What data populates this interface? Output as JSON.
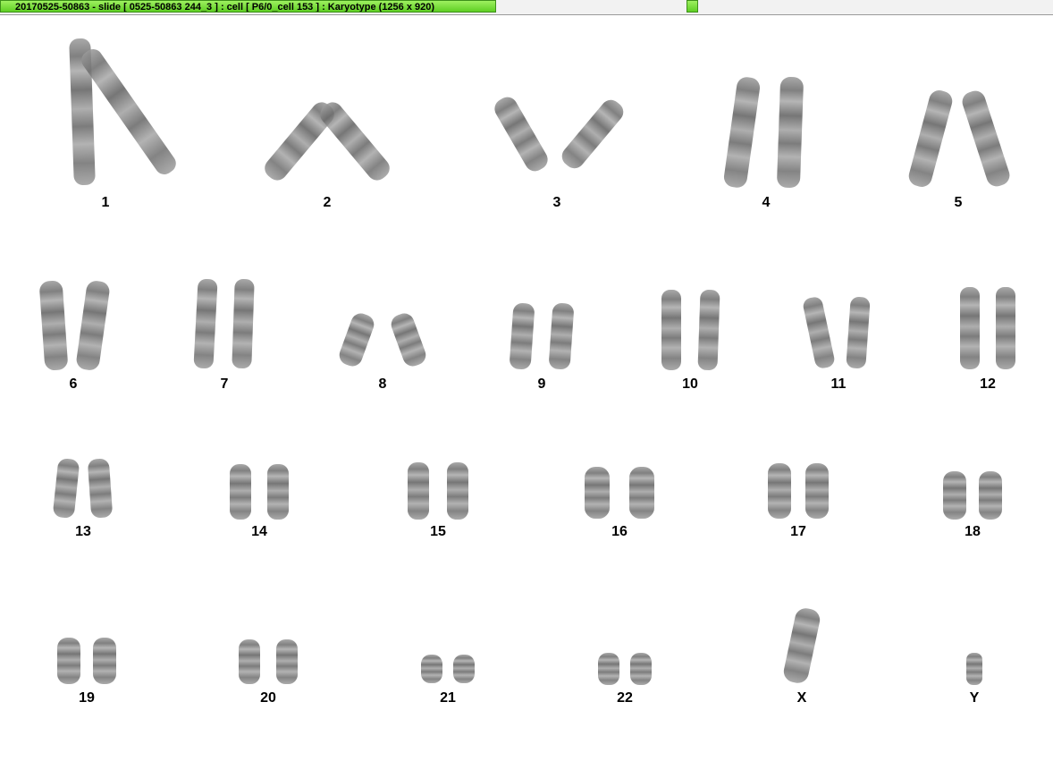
{
  "window": {
    "title": "20170525-50863 - slide [ 0525-50863 244_3 ] : cell [ P6/0_cell 153 ] : Karyotype  (1256 x 920)"
  },
  "karyotype": {
    "labels": [
      "1",
      "2",
      "3",
      "4",
      "5",
      "6",
      "7",
      "8",
      "9",
      "10",
      "11",
      "12",
      "13",
      "14",
      "15",
      "16",
      "17",
      "18",
      "19",
      "20",
      "21",
      "22",
      "X",
      "Y"
    ]
  }
}
